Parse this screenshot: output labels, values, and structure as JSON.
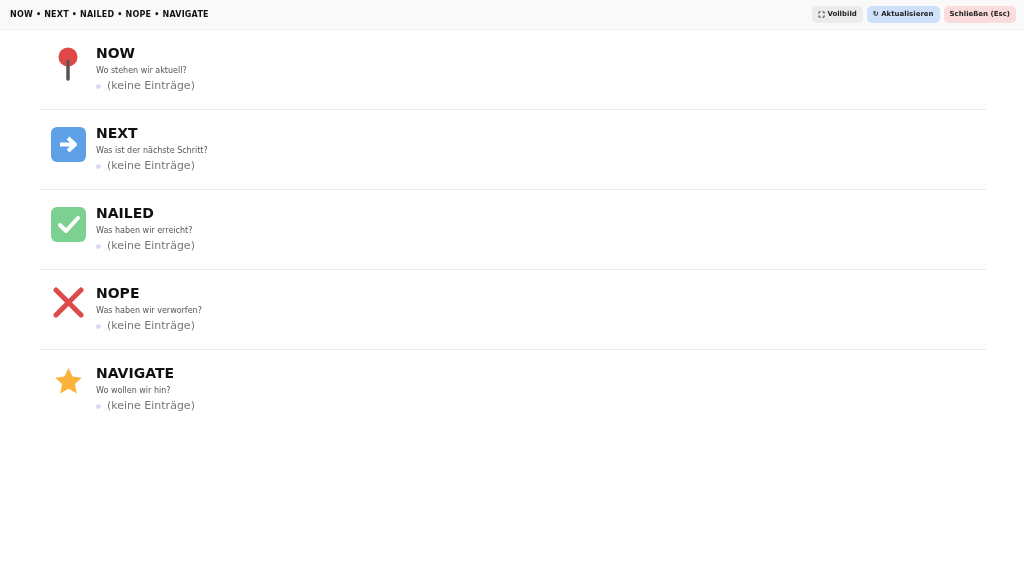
{
  "header": {
    "title": "NOW • NEXT • NAILED • NOPE • NAVIGATE",
    "buttons": [
      {
        "kind": "fullscreen",
        "label": "Vollbild"
      },
      {
        "kind": "refresh",
        "label": "↻ Aktualisieren"
      },
      {
        "kind": "close",
        "label": "Schließen (Esc)"
      }
    ]
  },
  "sections": [
    {
      "kind": "pin",
      "title": "NOW",
      "question": "Wo stehen wir aktuell?",
      "entries": [
        "(keine Einträge)"
      ]
    },
    {
      "kind": "arrow",
      "title": "NEXT",
      "question": "Was ist der nächste Schritt?",
      "entries": [
        "(keine Einträge)"
      ]
    },
    {
      "kind": "check",
      "title": "NAILED",
      "question": "Was haben wir erreicht?",
      "entries": [
        "(keine Einträge)"
      ]
    },
    {
      "kind": "cross",
      "title": "NOPE",
      "question": "Was haben wir verworfen?",
      "entries": [
        "(keine Einträge)"
      ]
    },
    {
      "kind": "star",
      "title": "NAVIGATE",
      "question": "Wo wollen wir hin?",
      "entries": [
        "(keine Einträge)"
      ]
    }
  ]
}
